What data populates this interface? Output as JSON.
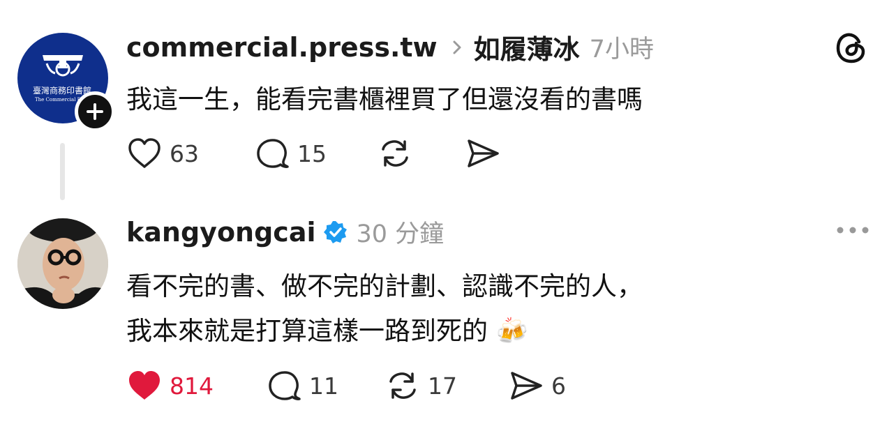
{
  "post": {
    "avatar_text_cn": "臺灣商務印書館",
    "avatar_text_en": "The Commercial Press",
    "username": "commercial.press.tw",
    "reply_to_user": "如履薄冰",
    "time": "7小時",
    "text": "我這一生，能看完書櫃裡買了但還沒看的書嗎",
    "likes": "63",
    "comments": "15",
    "liked": false
  },
  "reply": {
    "username": "kangyongcai",
    "verified": true,
    "time": "30 分鐘",
    "lines": [
      "看不完的書、做不完的計劃、認識不完的人，",
      "我本來就是打算這樣一路到死的 🍻"
    ],
    "likes": "814",
    "comments": "11",
    "reposts": "17",
    "shares": "6",
    "liked": true
  },
  "colors": {
    "like_red": "#e0193c",
    "verified_blue": "#1d9bf0",
    "brand_navy": "#0f2f8c"
  },
  "icons": [
    "threads-logo-icon",
    "plus-icon",
    "heart-icon",
    "comment-icon",
    "repost-icon",
    "share-icon",
    "more-icon",
    "verified-badge-icon",
    "chevron-right-icon"
  ]
}
